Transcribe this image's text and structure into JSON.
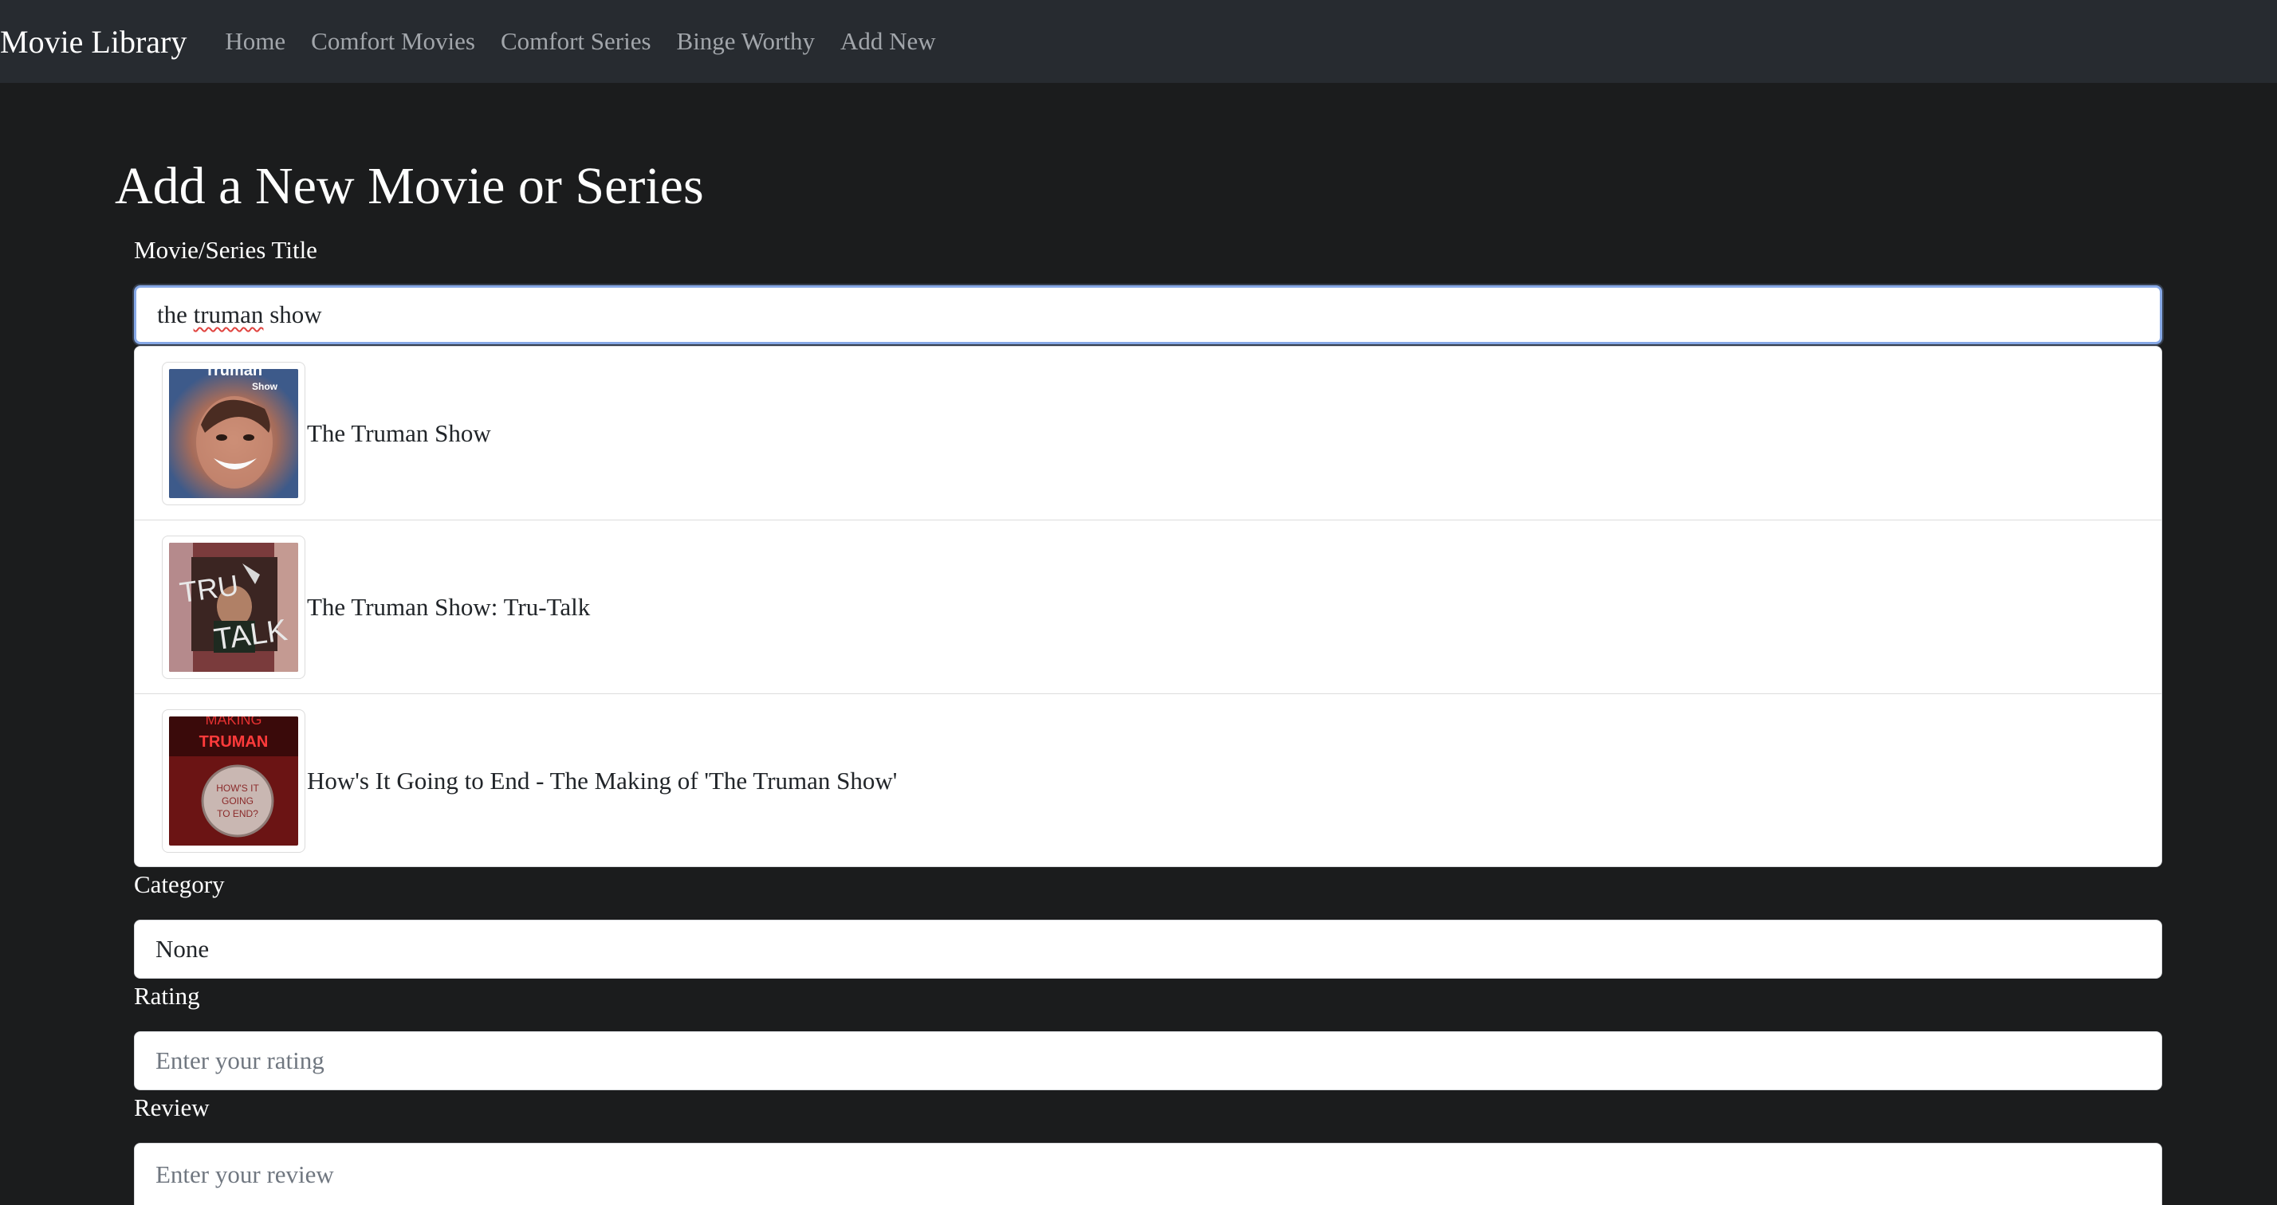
{
  "nav": {
    "brand": "Movie Library",
    "links": [
      "Home",
      "Comfort Movies",
      "Comfort Series",
      "Binge Worthy",
      "Add New"
    ]
  },
  "page": {
    "title": "Add a New Movie or Series"
  },
  "form": {
    "title_label": "Movie/Series Title",
    "title_value_prefix": "the ",
    "title_value_misspelled": "truman",
    "title_value_suffix": " show",
    "category_label": "Category",
    "category_value": "None",
    "rating_label": "Rating",
    "rating_placeholder": "Enter your rating",
    "review_label": "Review",
    "review_placeholder": "Enter your review"
  },
  "suggestions": [
    {
      "title": "The Truman Show",
      "poster_icon": "truman-show-poster"
    },
    {
      "title": "The Truman Show: Tru-Talk",
      "poster_icon": "tru-talk-poster"
    },
    {
      "title": "How's It Going to End - The Making of 'The Truman Show'",
      "poster_icon": "making-of-poster"
    }
  ],
  "poster_text": {
    "truman_top": "Truman",
    "truman_sub": "Show",
    "trutalk_1": "TRU",
    "trutalk_2": "TALK",
    "making_1": "MAKING",
    "making_2": "TRUMAN",
    "making_3": "HOW'S IT",
    "making_4": "GOING",
    "making_5": "TO END?"
  },
  "colors": {
    "page_bg": "#1b1c1d",
    "navbar_bg": "#272b30",
    "nav_link": "#a2a6ab",
    "focus_border": "#86a8e6"
  }
}
